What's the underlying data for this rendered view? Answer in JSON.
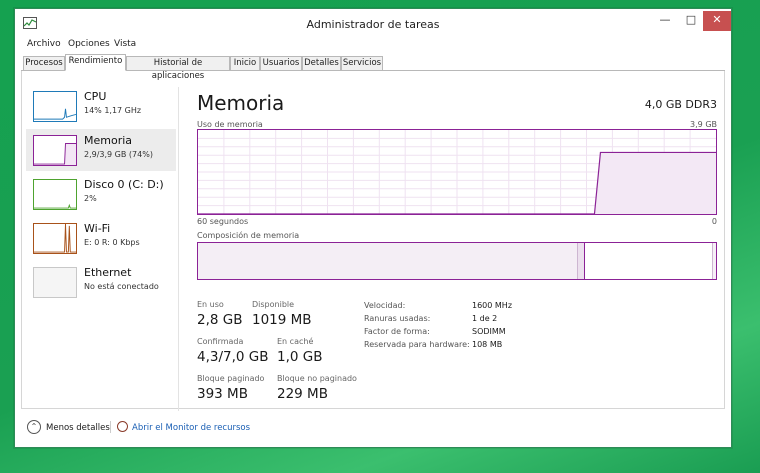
{
  "window": {
    "title": "Administrador de tareas",
    "controls": {
      "minimize": "—",
      "maximize": "□",
      "close": "✕"
    }
  },
  "menu": [
    "Archivo",
    "Opciones",
    "Vista"
  ],
  "tabs": [
    "Procesos",
    "Rendimiento",
    "Historial de aplicaciones",
    "Inicio",
    "Usuarios",
    "Detalles",
    "Servicios"
  ],
  "active_tab": "Rendimiento",
  "sidebar": {
    "items": [
      {
        "name": "CPU",
        "sub": "14% 1,17 GHz",
        "color": "#1f7ab8"
      },
      {
        "name": "Memoria",
        "sub": "2,9/3,9 GB (74%)",
        "color": "#8b2296"
      },
      {
        "name": "Disco 0 (C: D:)",
        "sub": "2%",
        "color": "#4ea32f"
      },
      {
        "name": "Wi-Fi",
        "sub": "E: 0 R: 0 Kbps",
        "color": "#a8521a"
      },
      {
        "name": "Ethernet",
        "sub": "No está conectado",
        "color": "#b8b8b8"
      }
    ]
  },
  "main": {
    "title": "Memoria",
    "spec": "4,0 GB DDR3",
    "usage_label": "Uso de memoria",
    "usage_max": "3,9 GB",
    "time_left": "60 segundos",
    "time_right": "0",
    "composition_label": "Composición de memoria",
    "usage_fraction": 0.74
  },
  "stats": {
    "in_use_label": "En uso",
    "in_use": "2,8 GB",
    "available_label": "Disponible",
    "available": "1019 MB",
    "committed_label": "Confirmada",
    "committed": "4,3/7,0 GB",
    "cached_label": "En caché",
    "cached": "1,0 GB",
    "paged_label": "Bloque paginado",
    "paged": "393 MB",
    "nonpaged_label": "Bloque no paginado",
    "nonpaged": "229 MB"
  },
  "details": [
    {
      "k": "Velocidad:",
      "v": "1600 MHz"
    },
    {
      "k": "Ranuras usadas:",
      "v": "1 de 2"
    },
    {
      "k": "Factor de forma:",
      "v": "SODIMM"
    },
    {
      "k": "Reservada para hardware:",
      "v": "108 MB"
    }
  ],
  "footer": {
    "less_details": "Menos detalles",
    "monitor_link": "Abrir el Monitor de recursos"
  }
}
